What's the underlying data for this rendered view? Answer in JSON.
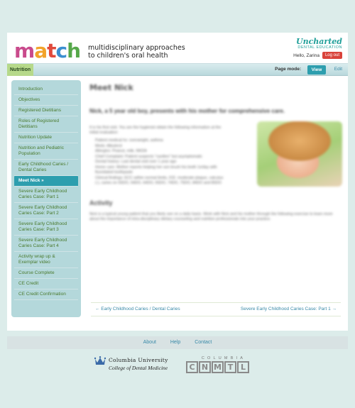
{
  "header": {
    "logo_letters": [
      "m",
      "a",
      "t",
      "c",
      "h"
    ],
    "logo_colors": [
      "#c94a8c",
      "#f2a32a",
      "#e04a3c",
      "#3b8fd0",
      "#56a84a"
    ],
    "tagline_line1": "multidisciplinary approaches",
    "tagline_line2": "to children's oral health",
    "brand_title": "Uncharted",
    "brand_sub": "DENTAL EDUCATION",
    "hello": "Hello, Zarina",
    "logout": "Log out"
  },
  "nav": {
    "section": "Nutrition",
    "page_mode_label": "Page mode:",
    "view": "View",
    "edit": "Edit"
  },
  "sidebar": {
    "items": [
      {
        "label": "Introduction",
        "active": false
      },
      {
        "label": "Objectives",
        "active": false
      },
      {
        "label": "Registered Dietitians",
        "active": false
      },
      {
        "label": "Roles of Registered Dietitians",
        "active": false
      },
      {
        "label": "Nutrition Update",
        "active": false
      },
      {
        "label": "Nutrition and Pediatric Population",
        "active": false
      },
      {
        "label": "Early Childhood Caries / Dental Caries",
        "active": false
      },
      {
        "label": "Meet Nick »",
        "active": true
      },
      {
        "label": "Severe Early Childhood Caries Case: Part 1",
        "active": false
      },
      {
        "label": "Severe Early Childhood Caries Case: Part 2",
        "active": false
      },
      {
        "label": "Severe Early Childhood Caries Case: Part 3",
        "active": false
      },
      {
        "label": "Severe Early Childhood Caries Case: Part 4",
        "active": false
      },
      {
        "label": "Activity wrap up & Exemplar video",
        "active": false
      },
      {
        "label": "Course Complete",
        "active": false
      },
      {
        "label": "CE Credit",
        "active": false
      },
      {
        "label": "CE Credit Confirmation",
        "active": false
      }
    ]
  },
  "content": {
    "title": "Meet Nick",
    "lead": "Nick, a 5 year old boy, presents with his mother for comprehensive care.",
    "intro": "It is his first visit. You are the hygienist obtain the following information at the initial evaluation:",
    "bullets": [
      "Patient medical hx: overweight, asthma",
      "Meds: Albuterol",
      "Allergies: Peanut, milk, NKDA",
      "Chief Complaint: Patient suspects \"cavities\" but asymptomatic",
      "Dental history: Last dental visit over 1 year ago",
      "Home care: Mother reports helping her son brush his teeth 1x/day with fluoridated toothpaste",
      "Clinical findings: ECC within normal limits, ICE: moderate plaque, calculus (-), caries on 55DO, 54DO, 64DO, 65DO, 74DO, 75DO, 84DO and 85DO"
    ],
    "activity_title": "Activity",
    "activity_text": "Nick is a typical young patient that you likely see on a daily basis. Work with Nick and his mother through the following exercise to learn more about the importance of intra-disciplinary dietary counseling and nutrition professionals into your practice."
  },
  "pager": {
    "prev": "← Early Childhood Caries / Dental Caries",
    "next": "Severe Early Childhood Caries Case: Part 1 →"
  },
  "footer": {
    "links": [
      "About",
      "Help",
      "Contact"
    ],
    "cu_name": "Columbia University",
    "cu_school": "College of Dental Medicine",
    "ccnmtl_top": "COLUMBIA",
    "ccnmtl_letters": [
      "C",
      "N",
      "M",
      "T",
      "L"
    ]
  }
}
